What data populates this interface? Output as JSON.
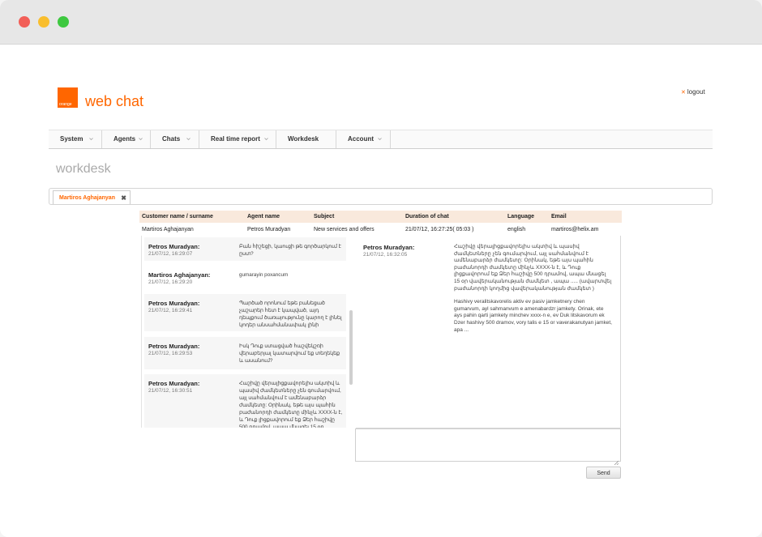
{
  "app": {
    "logo_text": "orange",
    "title": "web chat",
    "logout_label": "logout",
    "accent_color": "#ff6600"
  },
  "nav": {
    "items": [
      {
        "label": "System",
        "has_dropdown": true
      },
      {
        "label": "Agents",
        "has_dropdown": true
      },
      {
        "label": "Chats",
        "has_dropdown": true
      },
      {
        "label": "Real time report",
        "has_dropdown": true
      },
      {
        "label": "Workdesk",
        "has_dropdown": false
      },
      {
        "label": "Account",
        "has_dropdown": true
      }
    ]
  },
  "page": {
    "title": "workdesk"
  },
  "tabs": [
    {
      "label": "Martiros Aghajanyan",
      "close_icon": "close-icon"
    }
  ],
  "info": {
    "headers": [
      "Customer name / surname",
      "Agent name",
      "Subject",
      "Duration of chat",
      "Language",
      "Email"
    ],
    "row": [
      "Martiros Aghajanyan",
      "Petros Muradyan",
      "New services and offers",
      "21/07/12, 16:27:25( 05:03 )",
      "english",
      "martiros@helix.am"
    ]
  },
  "messages": [
    {
      "sender": "Petros Muradyan:",
      "time": "21/07/12, 16:29:07",
      "text": "Բան հիշեցի, կաուցի թե գործարկում է ըստ?"
    },
    {
      "sender": "Martiros Aghajanyan:",
      "time": "21/07/12, 16:29:20",
      "text": "gumarayin poxancum"
    },
    {
      "sender": "Petros Muradyan:",
      "time": "21/07/12, 16:29:41",
      "text": "Պարծած որոնում եթե բանեցած չաշարեր հետ է կապված, այդ դեպքում ծառայությունը կարող է լինել կոդեր անսահմանափակ լինի"
    },
    {
      "sender": "Petros Muradyan:",
      "time": "21/07/12, 16:29:53",
      "text": "Իսկ Դուք ստացված հաշվեկշռի վերաբերյալ կատարվում եք տեղեկեք և ասանում?"
    },
    {
      "sender": "Petros Muradyan:",
      "time": "21/07/12, 16:30:51",
      "text": "Հաշիվը վերալիցքավորելիս ակտիվ և պասիվ ժամկետները չեն գումարվում, այլ սահմանվում է ամենաբարձր ժամկետը: Օրինակ, եթե այս պահին բաժանորդի ժամկետը մինչև XXXX-ն է, և Դուք լիցքավորում եք Ձեր հաշիվը 500 դրամով, ապա մնացել 15 օր ..."
    }
  ],
  "detail": {
    "sender": "Petros Muradyan:",
    "time": "21/07/12, 16:32:05",
    "text_armenian": "Հաշիվը վերալիցքավորելիս ակտիվ և պասիվ ժամկետները չեն գումարվում, այլ սահմանվում է ամենաբարձր ժամկետը: Օրինակ, եթե այս պահին բաժանորդի ժամկետը մինչև XXXX-ն է, և Դուք լիցքավորում եք Ձեր հաշիվը 500 դրամով, ապա մնացել 15 օր վավերականության ժամկետ , ապա ..... (ավարտվել բաժանորդի կողմից վավերականության ժամկետ )",
    "text_latin": "Hashivy veralitskavorelis aktiv ev pasiv jamketnery chen gumarvum, ayl sahmanvum e amenabardzr jamkety. Orinak, ete ays pahin qarti jamkety minchev xxxx-n e, ev Duk litskavorum ek Dzer hashivy 500 dramov, vory talis e 15 or vaverakanutyan jamket, apa ..."
  },
  "reply": {
    "value": "",
    "send_label": "Send"
  }
}
